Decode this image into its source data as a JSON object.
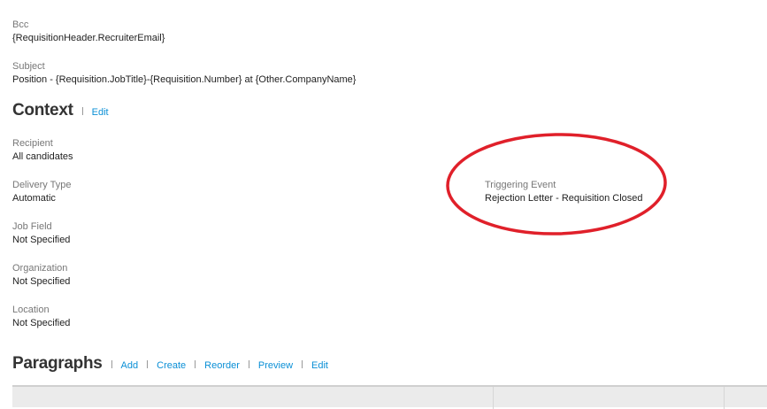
{
  "fields_top": [
    {
      "label": "Bcc",
      "value": "{RequisitionHeader.RecruiterEmail}"
    },
    {
      "label": "Subject",
      "value": "Position - {Requisition.JobTitle}-{Requisition.Number} at {Other.CompanyName}"
    }
  ],
  "context": {
    "title": "Context",
    "edit_label": "Edit",
    "fields": [
      {
        "label": "Recipient",
        "value": "All candidates"
      },
      {
        "label": "Delivery Type",
        "value": "Automatic"
      },
      {
        "label": "Job Field",
        "value": "Not Specified"
      },
      {
        "label": "Organization",
        "value": "Not Specified"
      },
      {
        "label": "Location",
        "value": "Not Specified"
      }
    ],
    "triggering_event": {
      "label": "Triggering Event",
      "value": "Rejection Letter - Requisition Closed"
    }
  },
  "paragraphs": {
    "title": "Paragraphs",
    "actions": [
      "Add",
      "Create",
      "Reorder",
      "Preview",
      "Edit"
    ]
  },
  "colors": {
    "link": "#0a8fd6",
    "annotation": "#e0202a"
  }
}
